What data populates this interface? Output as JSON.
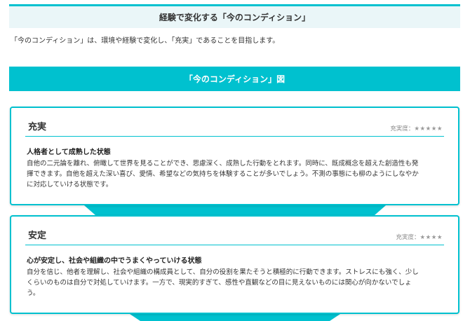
{
  "header": {
    "title": "経験で変化する「今のコンディション」"
  },
  "intro": "「今のコンディション」は、環境や経験で変化し、「充実」であることを目指します。",
  "banner": "「今のコンディション」図",
  "cards": [
    {
      "title": "充実",
      "rating_label": "充実度：",
      "rating_stars": "★★★★★",
      "rating_value": 5,
      "subtitle": "人格者として成熟した状態",
      "body_lines": [
        "自他の二元論を離れ、俯瞰して世界を見ることができ、思慮深く、成熟した行動をとれます。同時に、既成概念を超えた創造性も発",
        "揮できます。自他を超えた深い喜び、愛情、希望などの気持ちを体験することが多いでしょう。不測の事態にも柳のようにしなやか",
        "に対応していける状態です。"
      ]
    },
    {
      "title": "安定",
      "rating_label": "充実度：",
      "rating_stars": "★★★★",
      "rating_value": 4,
      "subtitle": "心が安定し、社会や組織の中でうまくやっていける状態",
      "body_lines": [
        "自分を信じ、他者を理解し、社会や組織の構成員として、自分の役割を果たそうと積極的に行動できます。ストレスにも強く、少し",
        "くらいのものは自分で対処していけます。一方で、現実的すぎて、感性や直観などの目に見えないものには関心が向かないでしょ",
        "う。"
      ]
    }
  ],
  "colors": {
    "accent": "#00c1cf",
    "header_bg": "#eaf6f8",
    "text": "#333333"
  }
}
